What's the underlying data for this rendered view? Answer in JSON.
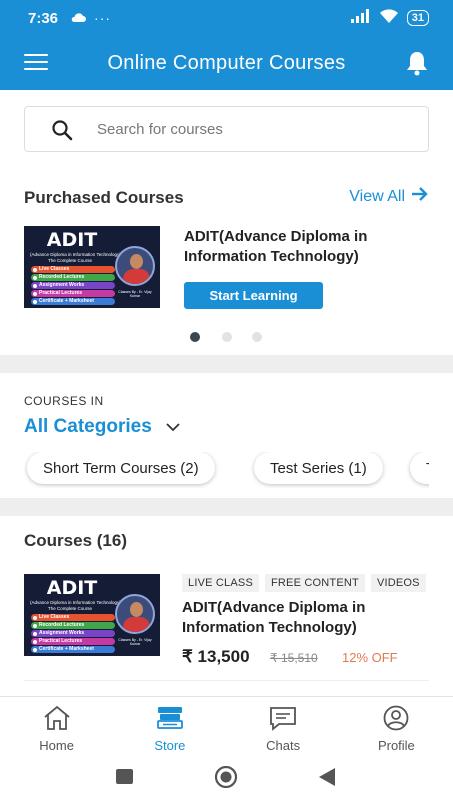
{
  "status_bar": {
    "time": "7:36",
    "dots": "···",
    "battery": "31"
  },
  "app_bar": {
    "title": "Online Computer Courses"
  },
  "search": {
    "placeholder": "Search for courses"
  },
  "purchased": {
    "title": "Purchased Courses",
    "view_all": "View All",
    "course": {
      "name": "ADIT(Advance Diploma in Information Technology)",
      "button": "Start Learning"
    },
    "page_count": 3,
    "active_page": 1
  },
  "thumbnail": {
    "title": "ADIT",
    "subtitle": "(Advance Diploma in Information Technology)",
    "subtitle2": "The Complete Course",
    "features": [
      "Live Classes",
      "Recorded Lectures",
      "Assignment Works",
      "Practical Lectures",
      "Certificate + Marksheet"
    ],
    "feature_colors": [
      "#e6532e",
      "#3fa64a",
      "#7a44c9",
      "#c43aa5",
      "#3a7bd5"
    ],
    "tag": "Classes By - Er. Vijay Kumar"
  },
  "categories": {
    "label": "COURSES IN",
    "selected": "All Categories",
    "chips": [
      "Short Term Courses (2)",
      "Test Series (1)",
      "T"
    ]
  },
  "courses": {
    "title": "Courses (16)",
    "item": {
      "tags": [
        "LIVE CLASS",
        "FREE CONTENT",
        "VIDEOS"
      ],
      "name": "ADIT(Advance Diploma in Information Technology)",
      "price": "₹ 13,500",
      "old_price": "₹ 15,510",
      "discount": "12% OFF"
    }
  },
  "bottom_nav": [
    {
      "label": "Home",
      "icon": "home-icon",
      "active": false
    },
    {
      "label": "Store",
      "icon": "store-icon",
      "active": true
    },
    {
      "label": "Chats",
      "icon": "chat-icon",
      "active": false
    },
    {
      "label": "Profile",
      "icon": "profile-icon",
      "active": false
    }
  ],
  "colors": {
    "primary": "#1a8fd6",
    "discount": "#e07a4f",
    "divider": "#eeeeee",
    "dot_active": "#3b4650",
    "dot_inactive": "#e2e2e2"
  }
}
